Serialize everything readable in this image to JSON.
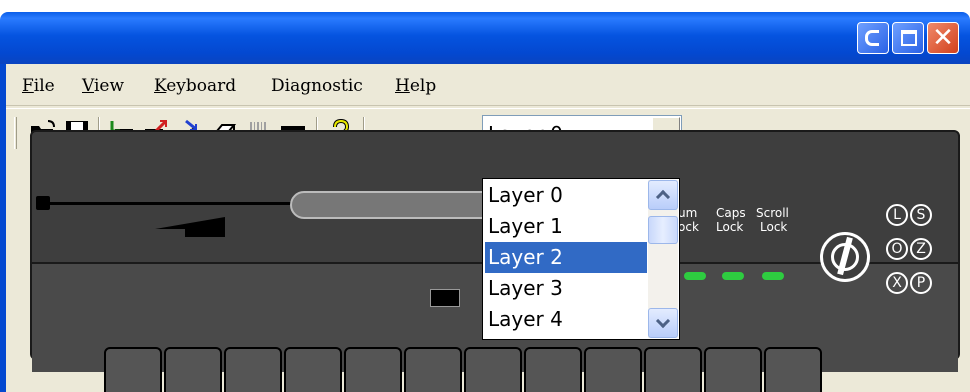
{
  "window": {
    "title": "",
    "controls": {
      "minimize": "minimize",
      "maximize": "maximize",
      "close": "close"
    }
  },
  "menu": {
    "items": [
      {
        "label": "File"
      },
      {
        "label": "View"
      },
      {
        "label": "Keyboard"
      },
      {
        "label": "Diagnostic"
      },
      {
        "label": "Help"
      }
    ]
  },
  "toolbar": {
    "icons": [
      "open-folder-icon",
      "save-icon",
      "new-layer-icon",
      "export-icon",
      "import-icon",
      "eraser-icon",
      "barcode-icon",
      "stripe-icon",
      "help-icon"
    ],
    "layer_combo": {
      "value": "Layer 0"
    }
  },
  "dropdown": {
    "options": [
      "Layer 0",
      "Layer 1",
      "Layer 2",
      "Layer 3",
      "Layer 4"
    ],
    "selected_index": 2
  },
  "keyboard": {
    "led_labels": {
      "num": "um",
      "num2": "ock",
      "caps": "Caps",
      "caps2": "Lock",
      "scroll": "Scroll",
      "scroll2": "Lock"
    },
    "mode_letters": [
      "L",
      "S",
      "O",
      "Z",
      "X",
      "P"
    ],
    "key_count": 12
  },
  "colors": {
    "titlebar": "#0554e0",
    "face": "#ece9d8",
    "selection": "#316ac5",
    "led": "#2ecc40"
  }
}
